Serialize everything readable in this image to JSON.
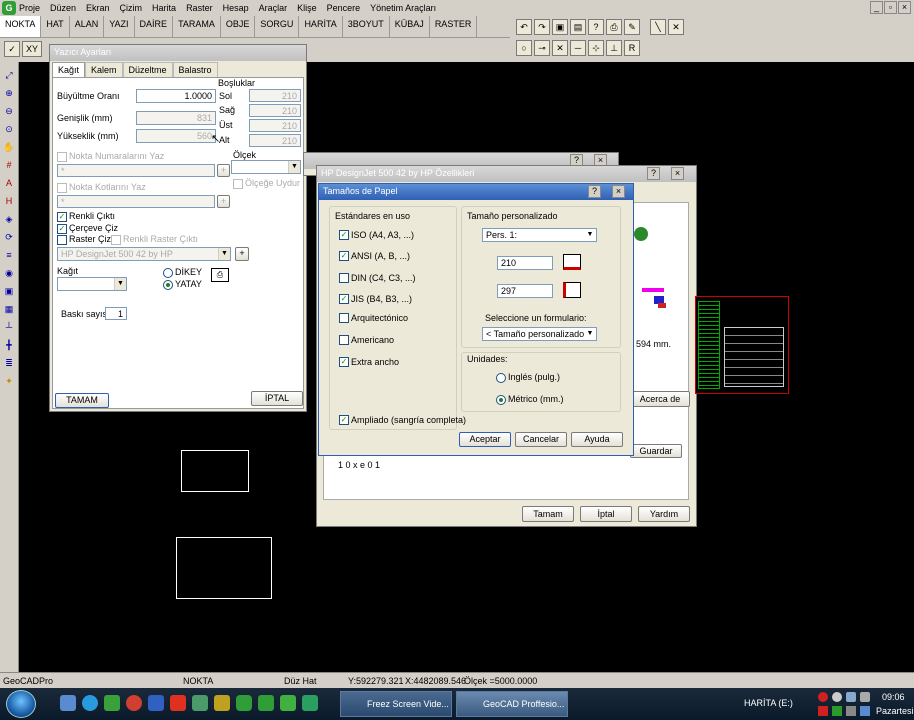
{
  "menu": {
    "items": [
      "Proje",
      "Düzen",
      "Ekran",
      "Çizim",
      "Harita",
      "Raster",
      "Hesap",
      "Araçlar",
      "Klişe",
      "Pencere",
      "Yönetim Araçları"
    ]
  },
  "tabs": [
    "NOKTA",
    "HAT",
    "ALAN",
    "YAZI",
    "DAİRE",
    "TARAMA",
    "OBJE",
    "SORGU",
    "HARİTA",
    "3BOYUT",
    "KÜBAJ",
    "RASTER"
  ],
  "toolrow2": {
    "check": "✓",
    "xy": "XY"
  },
  "yazici": {
    "title": "Yazıcı Ayarları",
    "tabs": [
      "Kağıt",
      "Kalem",
      "Düzeltme",
      "Balastro"
    ],
    "buyutme_label": "Büyültme Oranı",
    "buyutme_value": "1.0000",
    "bosluklar": "Boşluklar",
    "genislik_label": "Genişlik    (mm)",
    "genislik_value": "831",
    "yukseklik_label": "Yükseklik  (mm)",
    "yukseklik_value": "560",
    "sol": "Sol",
    "sol_value": "210",
    "sag": "Sağ",
    "sag_value": "210",
    "ust": "Üst",
    "ust_value": "210",
    "alt": "Alt",
    "alt_value": "210",
    "olcek": "Ölçek",
    "nokta_num": "Nokta Numaralarını Yaz",
    "nokta_num_value": "*",
    "nokta_kot": "Nokta Kotlarını Yaz",
    "nokta_kot_value": "*",
    "olcege_uydur": "Ölçeğe Uydur",
    "renkli_cikti": "Renkli Çıktı",
    "cerceve_ciz": "Çerçeve Çiz",
    "raster_ciz": "Raster Çiz",
    "renkli_raster": "Renkli Raster Çıktı",
    "printer": "HP DesignJet 500 42 by HP",
    "kagit": "Kağıt",
    "dikey": "DİKEY",
    "yatay": "YATAY",
    "baski_label": "Baskı sayısı",
    "baski_value": "1",
    "tamam": "TAMAM",
    "iptal": "İPTAL"
  },
  "hp": {
    "title": "HP DesignJet 500 42 by HP Özellikleri",
    "mm_text": "594 mm.",
    "acerca": "Acerca de",
    "guardar": "Guardar",
    "tamam": "Tamam",
    "iptal": "İptal",
    "yardim": "Yardım",
    "partial_text": "1 0 x e 0 1"
  },
  "papel": {
    "title": "Tamaños de Papel",
    "estandares": "Estándares en uso",
    "iso": "ISO (A4, A3, ...)",
    "ansi": "ANSI (A, B, ...)",
    "din": "DIN (C4, C3, ...)",
    "jis": "JIS (B4, B3, ...)",
    "arq": "Arquitectónico",
    "americano": "Americano",
    "extra": "Extra ancho",
    "ampliado": "Ampliado (sangría completa)",
    "tam_pers": "Tamaño personalizado",
    "pers_value": "Pers. 1:",
    "w_value": "210",
    "h_value": "297",
    "seleccione": "Seleccione un formulario:",
    "form_value": "< Tamaño personalizado >",
    "unidades": "Unidades:",
    "ingles": "Inglés (pulg.)",
    "metrico": "Métrico (mm.)",
    "aceptar": "Aceptar",
    "cancelar": "Cancelar",
    "ayuda": "Ayuda"
  },
  "status": {
    "app": "GeoCADPro",
    "mode": "NOKTA",
    "line": "Düz Hat",
    "y": "Y:592279.321",
    "x": "X:4482089.546",
    "scale": "Ölçek =5000.0000"
  },
  "taskbar": {
    "task1": "Freez Screen Vide...",
    "task2": "GeoCAD Proffesio...",
    "harita": "HARİTA (E:)",
    "time": "09:06",
    "day": "Pazartesi"
  },
  "colors": {
    "accent": "#2f5fb3",
    "canvas": "#000000",
    "panel": "#d4d0c8"
  }
}
